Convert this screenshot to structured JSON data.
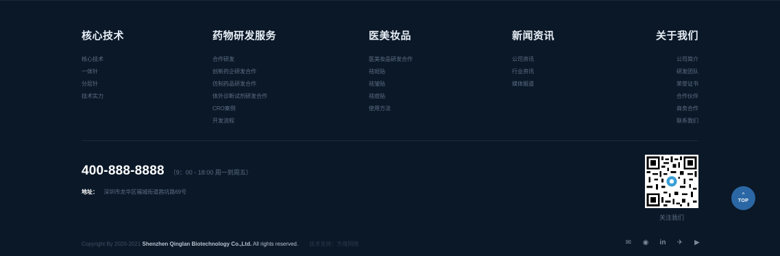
{
  "columns": [
    {
      "title": "核心技术",
      "items": [
        "核心技术",
        "一体针",
        "分层针",
        "技术实力"
      ]
    },
    {
      "title": "药物研发服务",
      "items": [
        "合作研发",
        "创新药企研发合作",
        "仿制药品研发合作",
        "体外诊断试剂研发合作",
        "CRO案例",
        "开发流程"
      ]
    },
    {
      "title": "医美妆品",
      "items": [
        "医美妆品研发合作",
        "祛斑贴",
        "祛皱贴",
        "祛痘贴",
        "使用方法"
      ]
    },
    {
      "title": "新闻资讯",
      "items": [
        "公司资讯",
        "行业资讯",
        "媒体报道"
      ]
    },
    {
      "title": "关于我们",
      "items": [
        "公司简介",
        "研发团队",
        "荣誉证书",
        "合作伙伴",
        "商务合作",
        "联系我们"
      ]
    }
  ],
  "contact": {
    "phone": "400-888-8888",
    "hours": "（9：00 - 18:00 周一到周五）",
    "address_label": "地址：",
    "address": "深圳市龙华区福城街道茜坑路69号"
  },
  "qr": {
    "caption": "关注我们"
  },
  "top_button": {
    "arrow": "^",
    "label": "TOP"
  },
  "footer": {
    "copyright_prefix": "Copyright By 2020-2021",
    "company": "Shenzhen Qinglan Biotechnology Co.,Ltd.",
    "rights": "All rights reserved.",
    "tech_support": "技术支持：方维网络"
  },
  "socials": [
    {
      "name": "wechat-icon",
      "glyph": "✉"
    },
    {
      "name": "weibo-icon",
      "glyph": "◉"
    },
    {
      "name": "linkedin-icon",
      "glyph": "in"
    },
    {
      "name": "twitter-icon",
      "glyph": "✈"
    },
    {
      "name": "youtube-icon",
      "glyph": "▶"
    }
  ]
}
